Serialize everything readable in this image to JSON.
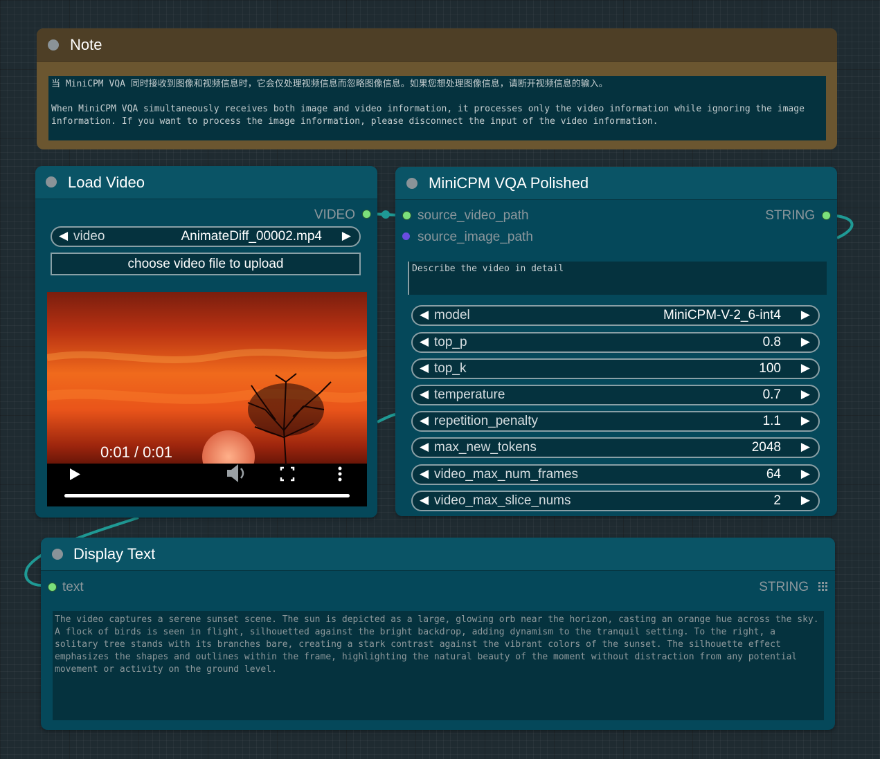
{
  "note": {
    "title": "Note",
    "text_zh": "当 MiniCPM VQA 同时接收到图像和视频信息时，它会仅处理视频信息而忽略图像信息。如果您想处理图像信息，请断开视频信息的输入。",
    "text_en": "When MiniCPM VQA simultaneously receives both image and video information, it processes only the video information while ignoring the image information. If you want to process the image information, please disconnect the input of the video information."
  },
  "load_video": {
    "title": "Load Video",
    "output_label": "VIDEO",
    "video_widget": {
      "label": "video",
      "value": "AnimateDiff_00002.mp4"
    },
    "upload_button": "choose video file to upload",
    "player": {
      "time": "0:01 / 0:01",
      "progress": 1.0
    }
  },
  "minicpm": {
    "title": "MiniCPM VQA Polished",
    "inputs": [
      {
        "label": "source_video_path"
      },
      {
        "label": "source_image_path"
      }
    ],
    "output_label": "STRING",
    "prompt": "Describe the video in detail",
    "widgets": [
      {
        "label": "model",
        "value": "MiniCPM-V-2_6-int4"
      },
      {
        "label": "top_p",
        "value": "0.8"
      },
      {
        "label": "top_k",
        "value": "100"
      },
      {
        "label": "temperature",
        "value": "0.7"
      },
      {
        "label": "repetition_penalty",
        "value": "1.1"
      },
      {
        "label": "max_new_tokens",
        "value": "2048"
      },
      {
        "label": "video_max_num_frames",
        "value": "64"
      },
      {
        "label": "video_max_slice_nums",
        "value": "2"
      }
    ]
  },
  "display_text": {
    "title": "Display Text",
    "input_label": "text",
    "output_label": "STRING",
    "output": "The video captures a serene sunset scene. The sun is depicted as a large, glowing orb near the horizon, casting an orange hue across the sky. A flock of birds is seen in flight, silhouetted against the bright backdrop, adding dynamism to the tranquil setting. To the right, a solitary tree stands with its branches bare, creating a stark contrast against the vibrant colors of the sunset. The silhouette effect emphasizes the shapes and outlines within the frame, highlighting the natural beauty of the moment without distraction from any potential movement or activity on the ground level."
  },
  "colors": {
    "node_body": "#05485a",
    "node_title": "#0a5466",
    "note_body": "#6b5630",
    "note_title": "#4e3f26",
    "link": "#1f9a95",
    "slot_green": "#7be07b",
    "slot_purple": "#6a4de0"
  }
}
